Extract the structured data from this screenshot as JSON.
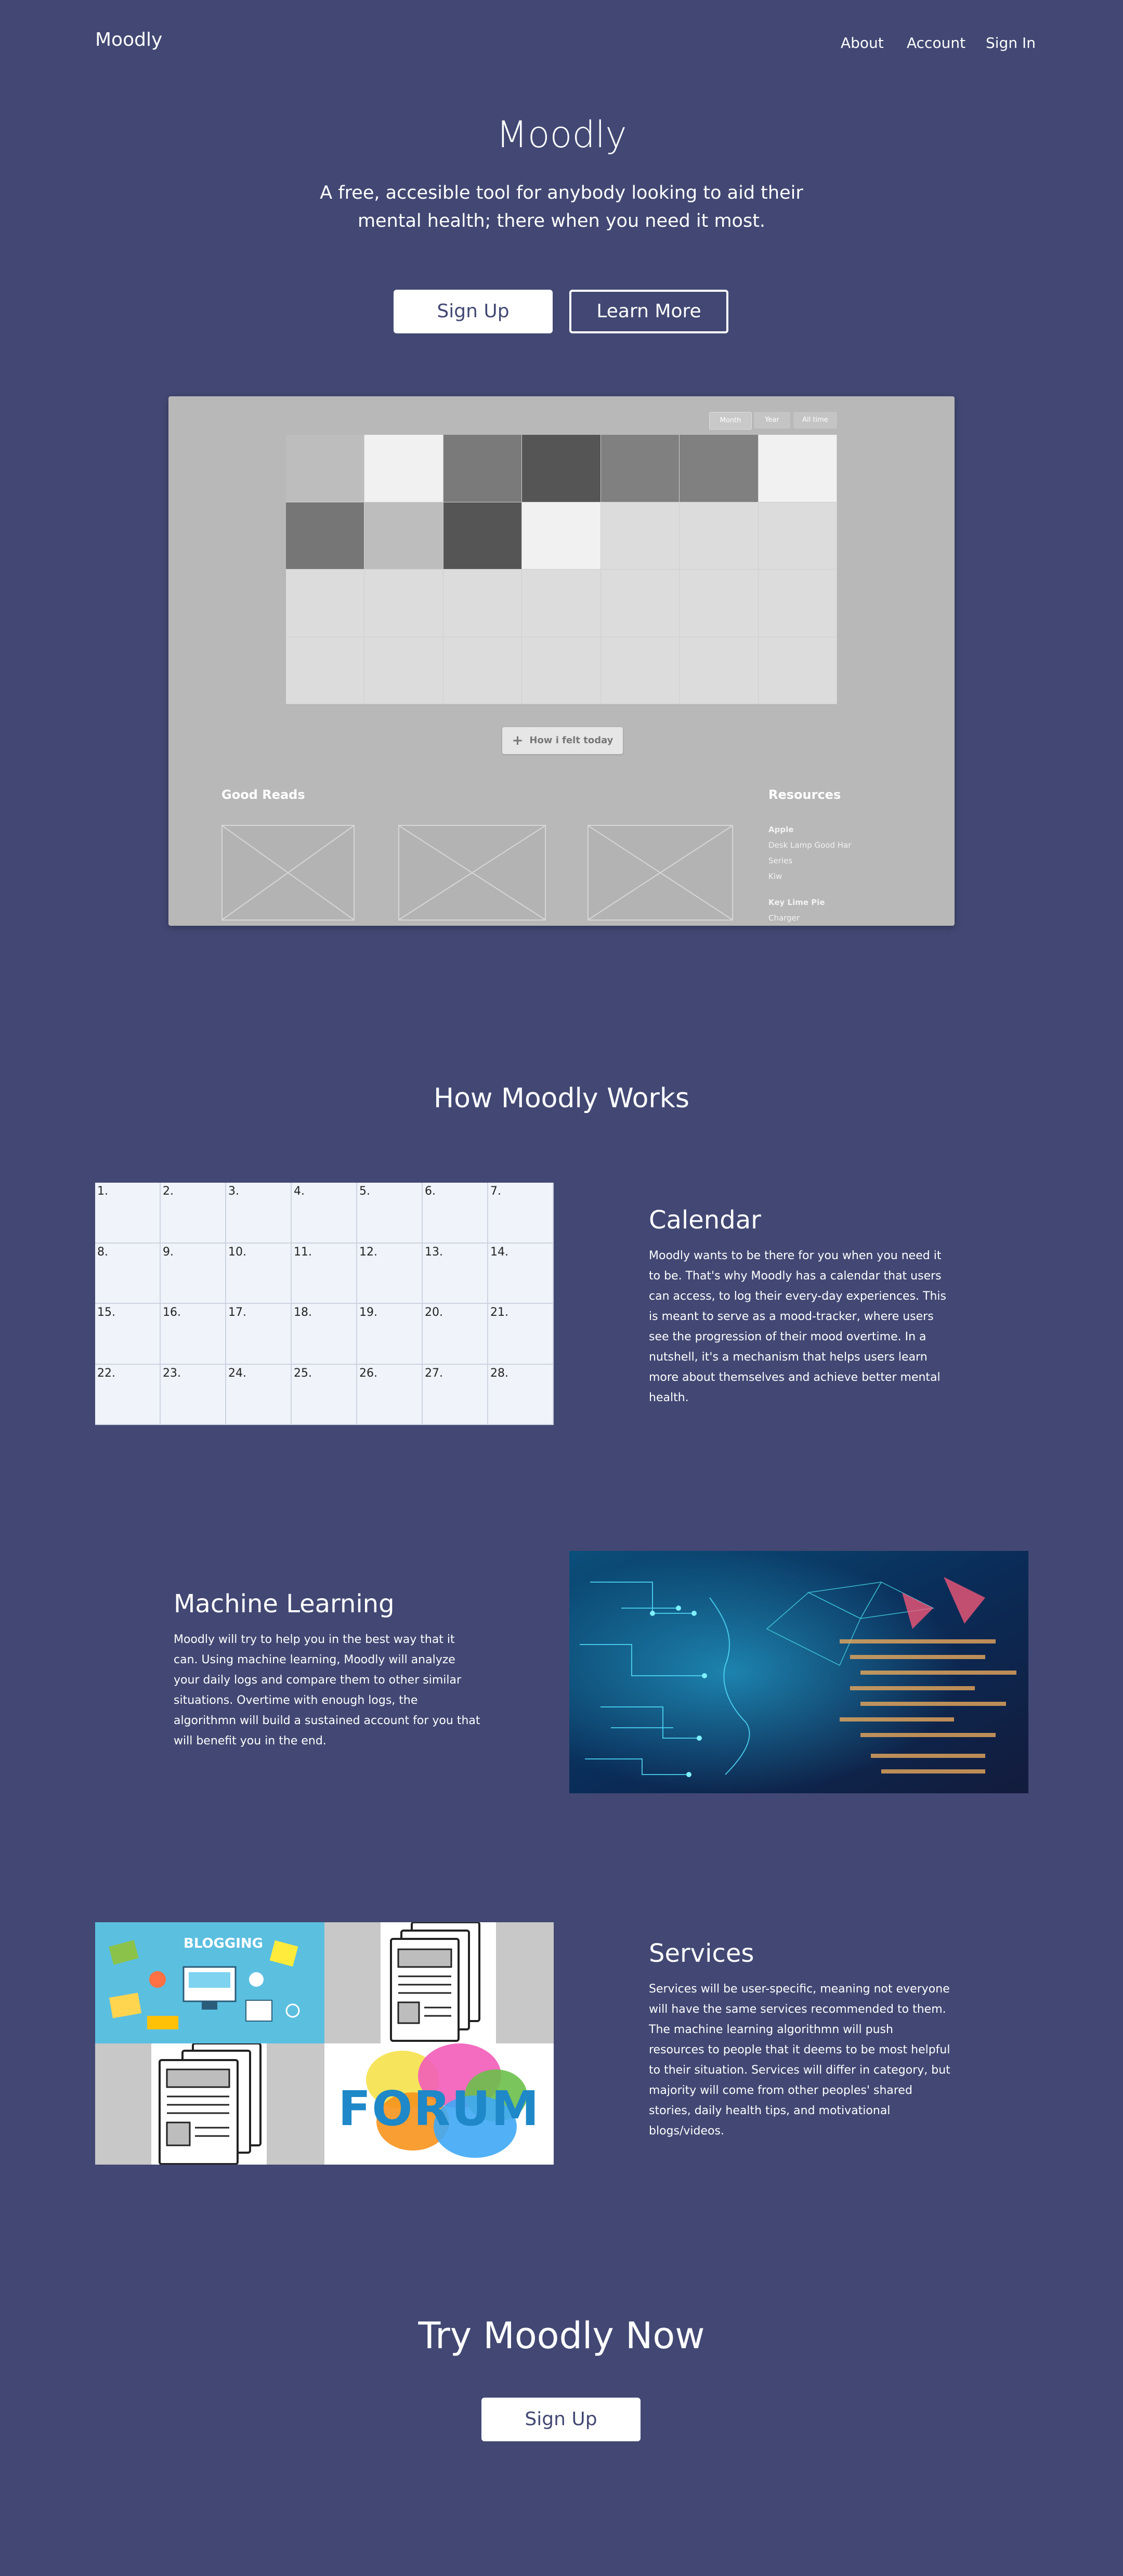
{
  "nav": {
    "brand": "Moodly",
    "links": [
      "About",
      "Account",
      "Sign In"
    ]
  },
  "hero": {
    "title": "Moodly",
    "subtitle": "A free, accesible tool for anybody looking to aid their mental health; there when you need it most.",
    "signup_label": "Sign Up",
    "learn_label": "Learn More"
  },
  "mockup": {
    "tabs": [
      "Month",
      "Year",
      "All time"
    ],
    "button_label": "How i felt today",
    "good_reads_title": "Good Reads",
    "resources_title": "Resources",
    "resources": [
      {
        "heading": "Apple",
        "items": [
          "Desk Lamp Good Har",
          "Series",
          "Kiw"
        ]
      },
      {
        "heading": "Key Lime Pie",
        "items": [
          "Charger"
        ]
      }
    ],
    "cell_colors": [
      "#bdbdbd",
      "#f1f1f1",
      "#7a7a7a",
      "#555555",
      "#808080",
      "#808080",
      "#f1f1f1",
      "#767676",
      "#bdbdbd",
      "#555555",
      "#f1f1f1",
      "#dcdcdc",
      "#dcdcdc",
      "#dcdcdc",
      "#dcdcdc",
      "#dcdcdc",
      "#dcdcdc",
      "#dcdcdc",
      "#dcdcdc",
      "#dcdcdc",
      "#dcdcdc",
      "#dcdcdc",
      "#dcdcdc",
      "#dcdcdc",
      "#dcdcdc",
      "#dcdcdc",
      "#dcdcdc",
      "#dcdcdc"
    ]
  },
  "how": {
    "title": "How Moodly Works",
    "calendar_days": [
      "1.",
      "2.",
      "3.",
      "4.",
      "5.",
      "6.",
      "7.",
      "8.",
      "9.",
      "10.",
      "11.",
      "12.",
      "13.",
      "14.",
      "15.",
      "16.",
      "17.",
      "18.",
      "19.",
      "20.",
      "21.",
      "22.",
      "23.",
      "24.",
      "25.",
      "26.",
      "27.",
      "28."
    ],
    "calendar": {
      "title": "Calendar",
      "text": "Moodly wants to be there for you when you need it to be. That's why Moodly has a calendar that users can access, to log their every-day experiences. This is meant to serve as a mood-tracker, where users see the progression of their mood overtime.  In a nutshell, it's a mechanism that helps users learn more about themselves and achieve better mental health."
    },
    "ml": {
      "title": "Machine Learning",
      "text": "Moodly will try to help you in the best way that it can. Using machine learning, Moodly will analyze your daily logs and compare them to other similar situations. Overtime with enough logs, the algorithmn will build a sustained account for you  that will benefit you in the end."
    },
    "services": {
      "title": "Services",
      "text": "Services will be user-specific, meaning not everyone will have the same services recommended to them. The machine learning algorithmn will push resources to people that it deems to be most helpful to their situation.  Services will differ in category, but majority will come from other peoples' shared stories, daily health tips, and motivational blogs/videos.",
      "blogging_label": "BLOGGING",
      "forum_label": "FORUM"
    }
  },
  "cta": {
    "title": "Try Moodly Now",
    "signup_label": "Sign Up"
  },
  "colors": {
    "background": "#424873",
    "white": "#ffffff",
    "mockup_bg": "#b8b8b8",
    "calendar_bg": "#f0f3fa"
  }
}
